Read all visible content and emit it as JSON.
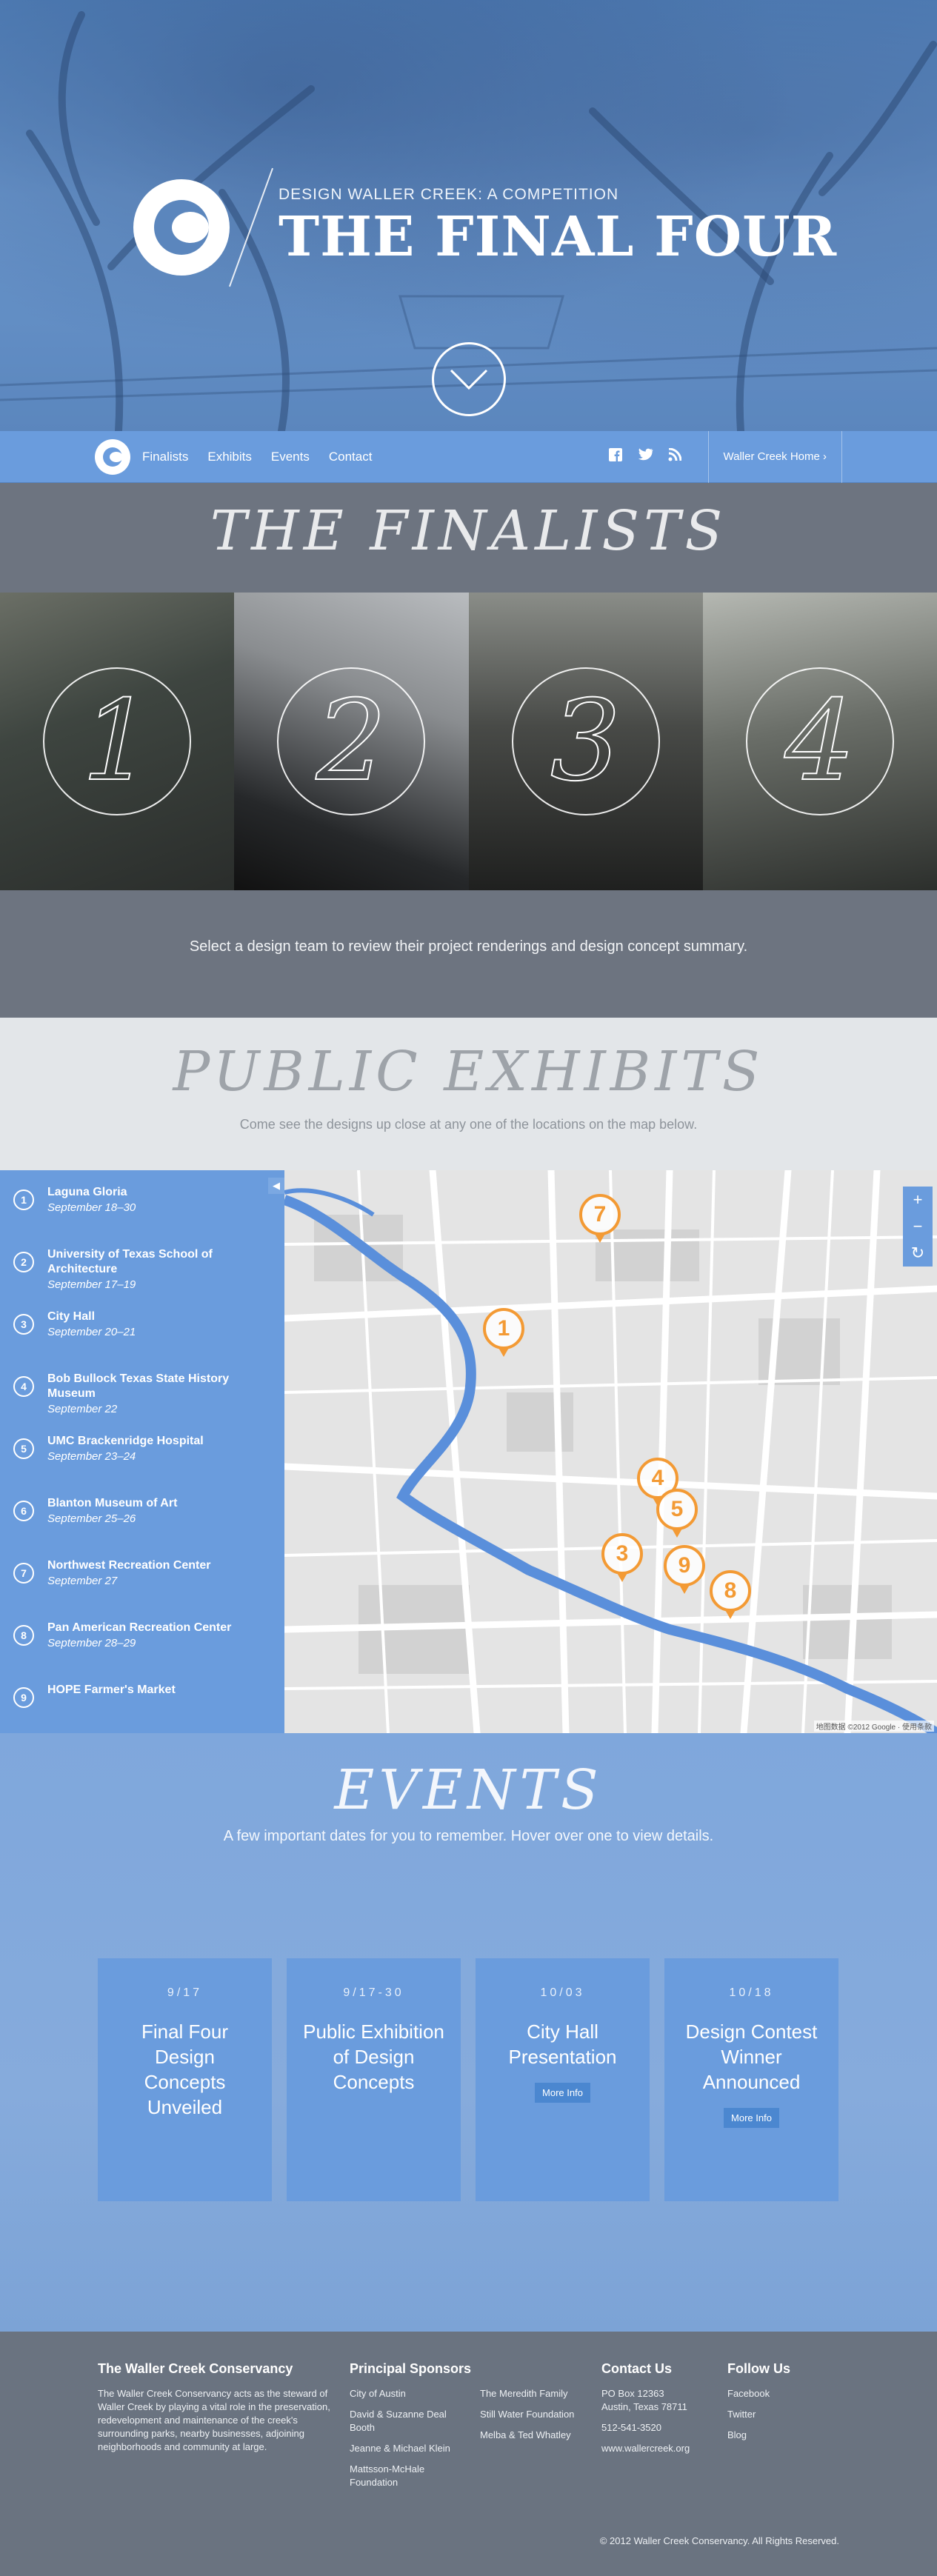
{
  "hero": {
    "subtitle": "DESIGN WALLER CREEK: A COMPETITION",
    "title": "THE FINAL FOUR"
  },
  "nav": {
    "items": [
      "Finalists",
      "Exhibits",
      "Events",
      "Contact"
    ],
    "home_link": "Waller Creek Home ›"
  },
  "finalists": {
    "title": "THE FINALISTS",
    "numbers": [
      "1",
      "2",
      "3",
      "4"
    ],
    "caption": "Select a design team to review their project renderings and design concept summary."
  },
  "exhibits": {
    "title": "PUBLIC EXHIBITS",
    "subtitle": "Come see the designs up close at any one of the locations on the map below.",
    "locations": [
      {
        "num": "1",
        "name": "Laguna Gloria",
        "date": "September 18–30"
      },
      {
        "num": "2",
        "name": "University of Texas School of Architecture",
        "date": "September 17–19"
      },
      {
        "num": "3",
        "name": "City Hall",
        "date": "September 20–21"
      },
      {
        "num": "4",
        "name": "Bob Bullock Texas State History Museum",
        "date": "September 22"
      },
      {
        "num": "5",
        "name": "UMC Brackenridge Hospital",
        "date": "September 23–24"
      },
      {
        "num": "6",
        "name": "Blanton Museum of Art",
        "date": "September 25–26"
      },
      {
        "num": "7",
        "name": "Northwest Recreation Center",
        "date": "September 27"
      },
      {
        "num": "8",
        "name": "Pan American Recreation Center",
        "date": "September 28–29"
      },
      {
        "num": "9",
        "name": "HOPE Farmer's Market",
        "date": ""
      }
    ],
    "map_pins": [
      "7",
      "1",
      "4",
      "5",
      "3",
      "9",
      "8"
    ],
    "map_zoom_in": "+",
    "map_zoom_out": "−",
    "map_reset": "↻",
    "map_credit": "地图数据 ©2012 Google · 使用条款"
  },
  "events": {
    "title": "EVENTS",
    "subtitle": "A few important dates for you to remember. Hover over one to view details.",
    "cards": [
      {
        "date": "9/17",
        "title": "Final Four Design Concepts Unveiled",
        "button": ""
      },
      {
        "date": "9/17-30",
        "title": "Public Exhibition of Design Concepts",
        "button": ""
      },
      {
        "date": "10/03",
        "title": "City Hall Presentation",
        "button": "More Info"
      },
      {
        "date": "10/18",
        "title": "Design Contest Winner Announced",
        "button": "More Info"
      }
    ]
  },
  "footer": {
    "about_title": "The Waller Creek Conservancy",
    "about_text": "The Waller Creek Conservancy acts as the steward of Waller Creek by playing a vital role in the preservation, redevelopment and maintenance of the creek's surrounding parks, nearby businesses, adjoining neighborhoods and community at large.",
    "sponsors_title": "Principal Sponsors",
    "sponsors_col1": [
      "City of Austin",
      "David & Suzanne Deal Booth",
      "Jeanne & Michael Klein",
      "Mattsson-McHale Foundation"
    ],
    "sponsors_col2": [
      "The Meredith Family",
      "Still Water Foundation",
      "Melba & Ted Whatley"
    ],
    "contact_title": "Contact Us",
    "contact_address": "PO Box 12363\nAustin, Texas 78711",
    "contact_phone": "512-541-3520",
    "contact_web": "www.wallercreek.org",
    "follow_title": "Follow Us",
    "follow_links": [
      "Facebook",
      "Twitter",
      "Blog"
    ],
    "copyright": "© 2012 Waller Creek Conservancy. All Rights Reserved."
  }
}
